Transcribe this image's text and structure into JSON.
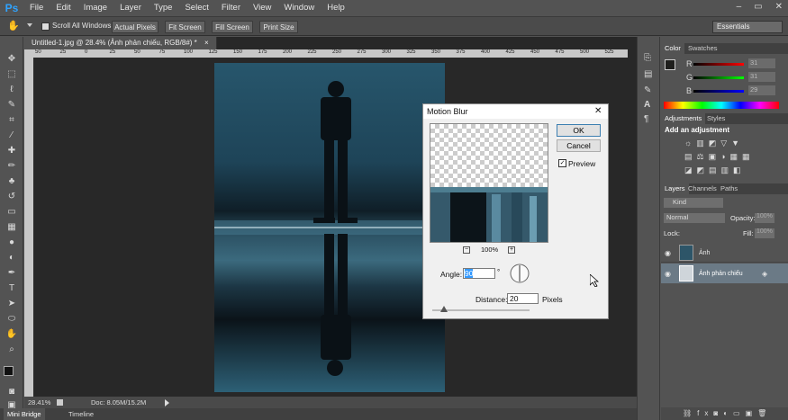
{
  "app": {
    "logo": "Ps"
  },
  "menu": [
    "File",
    "Edit",
    "Image",
    "Layer",
    "Type",
    "Select",
    "Filter",
    "View",
    "Window",
    "Help"
  ],
  "window_controls": {
    "minimize": "–",
    "restore": "▭",
    "close": "✕"
  },
  "options": {
    "scroll_all": "Scroll All Windows",
    "actual_pixels": "Actual Pixels",
    "fit_screen": "Fit Screen",
    "fill_screen": "Fill Screen",
    "print_size": "Print Size",
    "workspace": "Essentials"
  },
  "document": {
    "tab_title": "Untitled-1.jpg @ 28.4% (Ảnh phản chiếu, RGB/8#) *",
    "zoom": "28.41%",
    "doc_size": "Doc: 8.05M/15.2M"
  },
  "ruler": {
    "h_ticks": [
      "50",
      "25",
      "0",
      "25",
      "50",
      "75",
      "100",
      "125",
      "150",
      "175",
      "200",
      "225",
      "250",
      "275",
      "300",
      "325",
      "350",
      "375",
      "400",
      "425",
      "450",
      "475",
      "500",
      "525"
    ]
  },
  "bottom_tabs": {
    "mini_bridge": "Mini Bridge",
    "timeline": "Timeline"
  },
  "color_panel": {
    "tabs": [
      "Color",
      "Swatches"
    ],
    "r_label": "R",
    "g_label": "G",
    "b_label": "B",
    "r": "31",
    "g": "31",
    "b": "29"
  },
  "adjustments_panel": {
    "tabs": [
      "Adjustments",
      "Styles"
    ],
    "heading": "Add an adjustment"
  },
  "layers_panel": {
    "tabs": [
      "Layers",
      "Channels",
      "Paths"
    ],
    "filter": "Kind",
    "blend": "Normal",
    "opacity_label": "Opacity:",
    "opacity": "100%",
    "lock_label": "Lock:",
    "fill_label": "Fill:",
    "fill": "100%",
    "layers": [
      {
        "name": "Ảnh"
      },
      {
        "name": "Ảnh phản chiếu"
      }
    ]
  },
  "dialog": {
    "title": "Motion Blur",
    "ok": "OK",
    "cancel": "Cancel",
    "preview_label": "Preview",
    "zoom": "100%",
    "zoom_minus": "−",
    "zoom_plus": "+",
    "angle_label": "Angle:",
    "angle": "90",
    "degree": "°",
    "distance_label": "Distance:",
    "distance": "20",
    "pixels": "Pixels",
    "close": "✕"
  },
  "colors": {
    "accent": "#2fa3ff",
    "canvas_bg": "#282828",
    "panel_bg": "#535353"
  }
}
